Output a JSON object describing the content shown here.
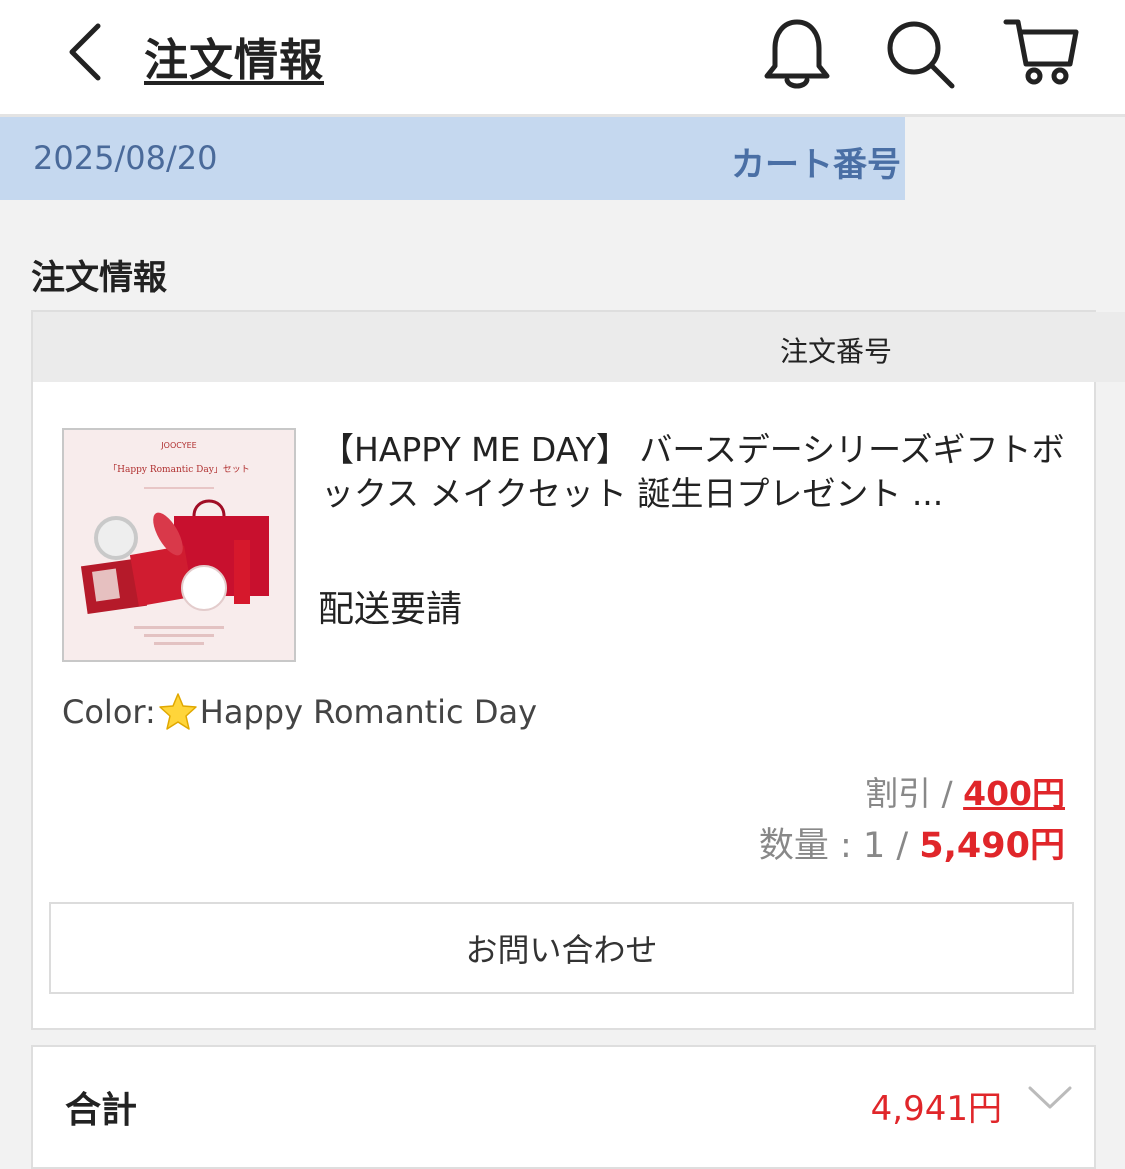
{
  "header": {
    "title": "注文情報",
    "icons": [
      "chevron-left-icon",
      "bell-icon",
      "search-icon",
      "cart-icon"
    ]
  },
  "date_bar": {
    "date": "2025/08/20",
    "cart_number_label": "カート番号"
  },
  "section": {
    "title": "注文情報"
  },
  "order": {
    "order_number_label": "注文番号",
    "product_title": "【HAPPY ME DAY】 バースデーシリーズギフトボックス メイクセット 誕生日プレゼント ...",
    "delivery_status": "配送要請",
    "color_prefix": "Color:",
    "color_value": "Happy Romantic Day",
    "discount_label": "割引 / ",
    "discount_value": "400円",
    "quantity_label": "数量 : 1 / ",
    "price_value": "5,490円",
    "inquiry_button": "お問い合わせ",
    "thumbnail": {
      "brand": "JOOCYEE",
      "caption": "「Happy Romantic Day」セット"
    }
  },
  "total": {
    "label": "合計",
    "value": "4,941円"
  },
  "colors": {
    "accent_red": "#e0262a",
    "date_bar_bg": "#c5d8ef",
    "date_bar_text": "#4a6fa5"
  }
}
